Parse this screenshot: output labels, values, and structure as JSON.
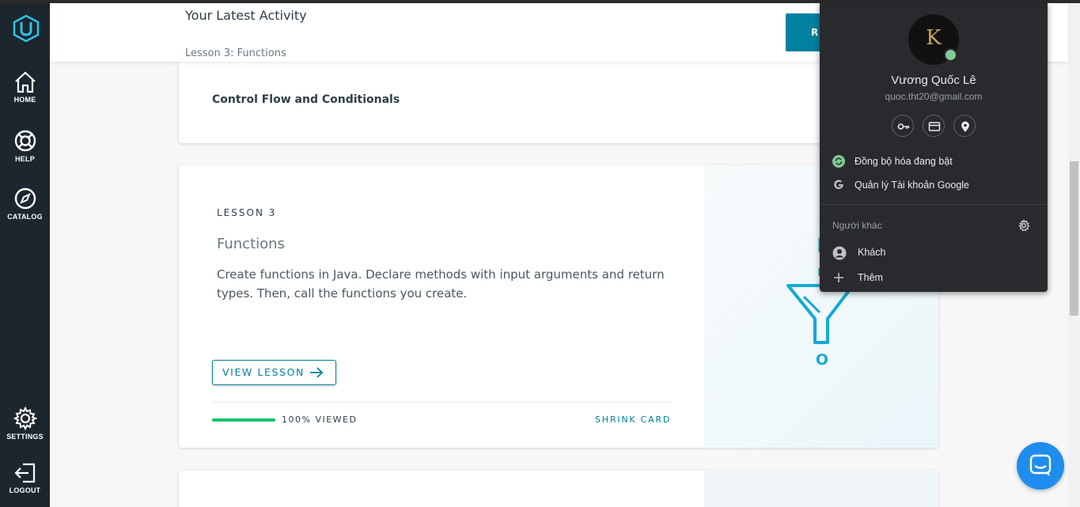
{
  "sidebar": {
    "items": [
      {
        "label": "HOME",
        "icon": "home-icon"
      },
      {
        "label": "HELP",
        "icon": "lifebuoy-icon"
      },
      {
        "label": "CATALOG",
        "icon": "compass-icon"
      },
      {
        "label": "SETTINGS",
        "icon": "gear-icon"
      },
      {
        "label": "LOGOUT",
        "icon": "logout-icon"
      }
    ]
  },
  "activity": {
    "title": "Your Latest Activity",
    "lesson": "Lesson 3: Functions",
    "resume_label": "RE"
  },
  "previous_card": {
    "title": "Control Flow and Conditionals"
  },
  "lesson_card": {
    "number_label": "LESSON 3",
    "title": "Functions",
    "description": "Create functions in Java. Declare methods with input arguments and return types. Then, call the functions you create.",
    "view_button": "VIEW LESSON",
    "progress_fraction": 1.0,
    "viewed_text": "100% VIEWED",
    "shrink_label": "SHRINK CARD",
    "art_letter": "O"
  },
  "profile_popup": {
    "avatar_letter": "K",
    "name": "Vương Quốc Lê",
    "email": "quoc.tht20@gmail.com",
    "sync_status": "Đồng bộ hóa đang bật",
    "manage_account": "Quản lý Tài khoản Google",
    "others_label": "Người khác",
    "guest_label": "Khách",
    "add_label": "Thêm"
  },
  "colors": {
    "sidebar_bg": "#1c262f",
    "accent": "#02809f",
    "progress": "#15c26b",
    "popup_bg": "#292a2d",
    "chat": "#1f8ded",
    "art": "#16a9d8"
  }
}
